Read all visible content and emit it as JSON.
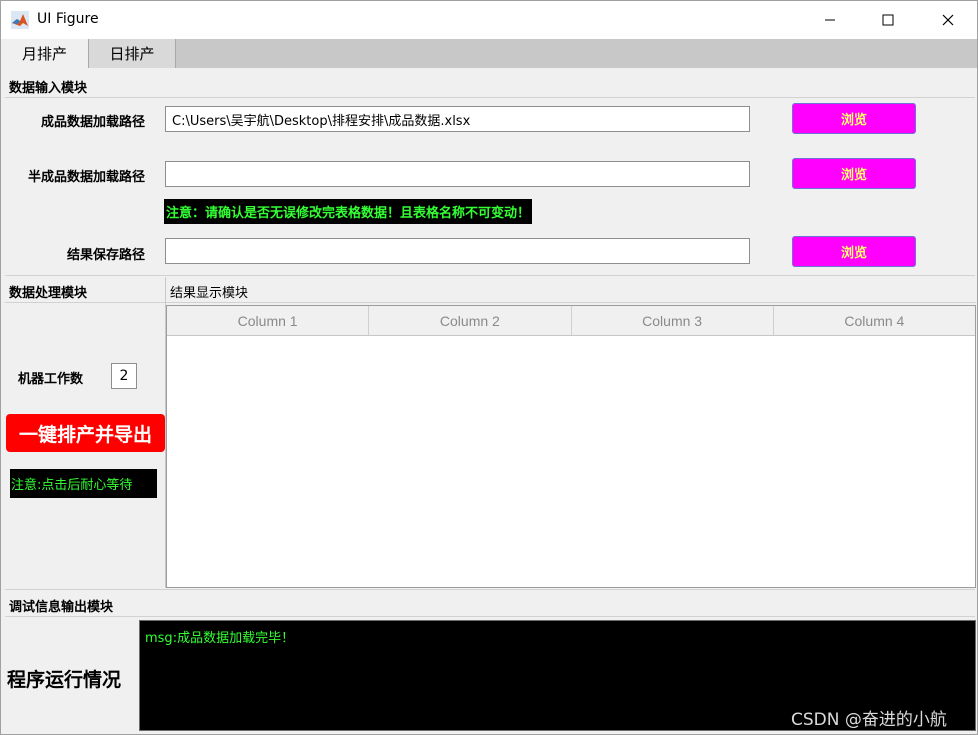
{
  "window": {
    "title": "UI Figure"
  },
  "tabs": [
    {
      "label": "月排产",
      "active": true
    },
    {
      "label": "日排产",
      "active": false
    }
  ],
  "input_module": {
    "title": "数据输入模块",
    "finished_label": "成品数据加载路径",
    "finished_value": "C:\\Users\\吴宇航\\Desktop\\排程安排\\成品数据.xlsx",
    "semi_label": "半成品数据加载路径",
    "semi_value": "",
    "warning": "注意：请确认是否无误修改完表格数据！且表格名称不可变动！",
    "result_label": "结果保存路径",
    "result_value": "",
    "browse_label": "浏览"
  },
  "processing_module": {
    "title": "数据处理模块",
    "machine_label": "机器工作数",
    "machine_value": "2",
    "run_button": "一键排产并导出",
    "note": "注意:点击后耐心等待"
  },
  "result_module": {
    "title": "结果显示模块",
    "columns": [
      "Column 1",
      "Column 2",
      "Column 3",
      "Column 4"
    ]
  },
  "debug_module": {
    "title": "调试信息输出模块",
    "status_label": "程序运行情况",
    "log": "msg:成品数据加载完毕！"
  },
  "watermark": "CSDN @奋进的小航",
  "colors": {
    "browse_bg": "#ff00ff",
    "browse_text": "#ffff66",
    "run_bg": "#ff0000",
    "console_bg": "#000000",
    "console_text": "#33ff33"
  }
}
